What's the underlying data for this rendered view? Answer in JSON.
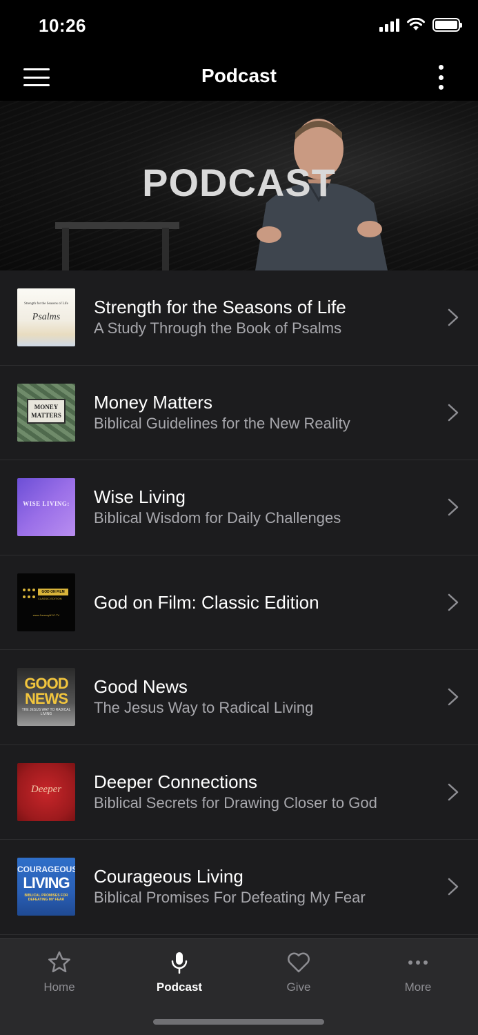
{
  "status_bar": {
    "time": "10:26"
  },
  "nav": {
    "title": "Podcast"
  },
  "hero": {
    "title": "PODCAST"
  },
  "podcasts": [
    {
      "title": "Strength for the Seasons of Life",
      "subtitle": "A Study Through the Book of Psalms",
      "thumb_text": [
        "Strength for the Seasons of Life",
        "Psalms"
      ]
    },
    {
      "title": "Money Matters",
      "subtitle": "Biblical Guidelines for the New Reality",
      "thumb_text": [
        "MONEY",
        "MATTERS"
      ]
    },
    {
      "title": "Wise Living",
      "subtitle": "Biblical Wisdom for Daily Challenges",
      "thumb_text": [
        "WISE LIVING:"
      ]
    },
    {
      "title": "God on Film: Classic Edition",
      "subtitle": "",
      "thumb_text": [
        "GOD ON FILM",
        "CLASSIC EDITION",
        "www.JourneyNYC.TV"
      ]
    },
    {
      "title": "Good News",
      "subtitle": "The Jesus Way to Radical Living",
      "thumb_text": [
        "GOOD",
        "NEWS",
        "THE JESUS WAY TO RADICAL LIVING"
      ]
    },
    {
      "title": "Deeper Connections",
      "subtitle": "Biblical Secrets for Drawing Closer to God",
      "thumb_text": [
        "Deeper"
      ]
    },
    {
      "title": "Courageous Living",
      "subtitle": "Biblical Promises For Defeating My Fear",
      "thumb_text": [
        "COURAGEOUS",
        "LIVING",
        "BIBLICAL PROMISES FOR DEFEATING MY FEAR"
      ]
    }
  ],
  "tabs": [
    {
      "label": "Home",
      "icon": "star-icon",
      "active": false
    },
    {
      "label": "Podcast",
      "icon": "microphone-icon",
      "active": true
    },
    {
      "label": "Give",
      "icon": "heart-icon",
      "active": false
    },
    {
      "label": "More",
      "icon": "more-dots-icon",
      "active": false
    }
  ],
  "colors": {
    "background": "#000000",
    "list_background": "#1c1c1e",
    "tab_bar": "#2a2a2c",
    "inactive_tab": "#8e8e93",
    "subtitle": "#a8a8ad"
  }
}
